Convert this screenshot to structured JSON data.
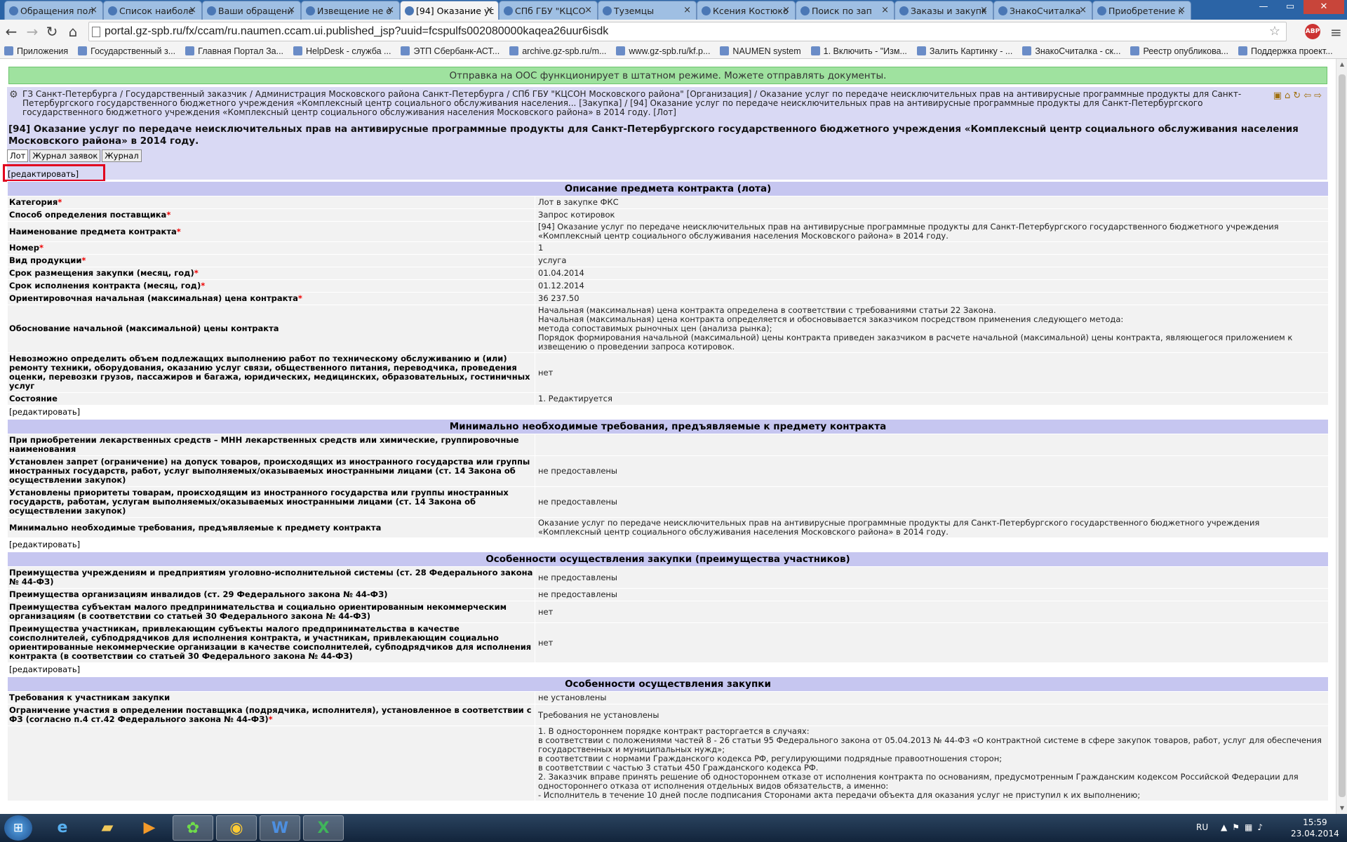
{
  "browser": {
    "tabs": [
      {
        "label": "Обращения пол"
      },
      {
        "label": "Список наиболе"
      },
      {
        "label": "Ваши обращени"
      },
      {
        "label": "Извещение не о"
      },
      {
        "label": "[94] Оказание ус"
      },
      {
        "label": "СПб ГБУ \"КЦСО"
      },
      {
        "label": "Туземцы"
      },
      {
        "label": "Ксения Костюко"
      },
      {
        "label": "Поиск по зап"
      },
      {
        "label": "Заказы и закупк"
      },
      {
        "label": "ЗнакоСчиталка"
      },
      {
        "label": "Приобретение к"
      }
    ],
    "url": "portal.gz-spb.ru/fx/ccam/ru.naumen.ccam.ui.published_jsp?uuid=fcspulfs002080000kaqea26uur6isdk",
    "abp_label": "ABP",
    "bookmarks": [
      {
        "label": "Приложения"
      },
      {
        "label": "Государственный з..."
      },
      {
        "label": "Главная Портал За..."
      },
      {
        "label": "HelpDesk - служба ..."
      },
      {
        "label": "ЭТП Сбербанк-АСТ..."
      },
      {
        "label": "archive.gz-spb.ru/m..."
      },
      {
        "label": "www.gz-spb.ru/kf.p..."
      },
      {
        "label": "NAUMEN system"
      },
      {
        "label": "1. Включить - \"Изм..."
      },
      {
        "label": "Залить Картинку - ..."
      },
      {
        "label": "ЗнакоСчиталка - ск..."
      },
      {
        "label": "Реестр опубликова..."
      },
      {
        "label": "Поддержка проект..."
      }
    ]
  },
  "page": {
    "status_message": "Отправка на ООС функционирует в штатном режиме. Можете отправлять документы.",
    "breadcrumb": "ГЗ Санкт-Петербурга / Государственный заказчик / Администрация Московского района Санкт-Петербурга / СПб ГБУ \"КЦСОН Московского района\" [Организация] / Оказание услуг по передаче неисключительных прав на антивирусные программные продукты для Санкт-Петербургского государственного бюджетного учреждения «Комплексный центр социального обслуживания населения... [Закупка] / [94] Оказание услуг по передаче неисключительных прав на антивирусные программные продукты для Санкт-Петербургского государственного бюджетного учреждения «Комплексный центр социального обслуживания населения Московского района» в 2014 году. [Лот]",
    "title": "[94] Оказание услуг по передаче неисключительных прав на антивирусные программные продукты для Санкт-Петербургского государственного бюджетного учреждения «Комплексный центр социального обслуживания населения Московского района» в 2014 году.",
    "tabs": [
      "Лот",
      "Журнал заявок",
      "Журнал"
    ],
    "edit_label": "[редактировать]",
    "sections": [
      {
        "title": "Описание предмета контракта (лота)",
        "rows": [
          {
            "label": "Категория",
            "required": "*",
            "value": "Лот в закупке ФКС"
          },
          {
            "label": "Способ определения поставщика",
            "required": "*",
            "value": "Запрос котировок"
          },
          {
            "label": "Наименование предмета контракта",
            "required": "*",
            "value": "[94] Оказание услуг по передаче неисключительных прав на антивирусные программные продукты для Санкт-Петербургского государственного бюджетного учреждения «Комплексный центр социального обслуживания населения Московского района» в 2014 году."
          },
          {
            "label": "Номер",
            "required": "*",
            "value": "1"
          },
          {
            "label": "Вид продукции",
            "required": "*",
            "value": "услуга"
          },
          {
            "label": "Срок размещения закупки (месяц, год)",
            "required": "*",
            "value": "01.04.2014"
          },
          {
            "label": "Срок исполнения контракта (месяц, год)",
            "required": "*",
            "value": "01.12.2014"
          },
          {
            "label": "Ориентировочная начальная (максимальная) цена контракта",
            "required": "*",
            "value": "36 237.50"
          },
          {
            "label": "Обоснование начальной (максимальной) цены контракта",
            "required": "",
            "value": "Начальная (максимальная) цена контракта определена в соответствии с требованиями статьи 22 Закона.\nНачальная (максимальная) цена контракта определяется и обосновывается заказчиком посредством применения следующего метода:\nметода сопоставимых рыночных цен (анализа рынка);\nПорядок формирования начальной (максимальной) цены контракта приведен заказчиком в расчете начальной (максимальной) цены контракта, являющегося приложением к извещению о проведении запроса котировок."
          },
          {
            "label": "Невозможно определить объем подлежащих выполнению работ по техническому обслуживанию и (или) ремонту техники, оборудования, оказанию услуг связи, общественного питания, переводчика, проведения оценки, перевозки грузов, пассажиров и багажа, юридических, медицинских, образовательных, гостиничных услуг",
            "required": "",
            "value": "нет"
          },
          {
            "label": "Состояние",
            "required": "",
            "value": "1. Редактируется"
          }
        ]
      },
      {
        "title": "Минимально необходимые требования, предъявляемые к предмету контракта",
        "rows": [
          {
            "label": "При приобретении лекарственных средств – МНН лекарственных средств или химические, группировочные наименования",
            "required": "",
            "value": ""
          },
          {
            "label": "Установлен запрет (ограничение) на допуск товаров, происходящих из иностранного государства или группы иностранных государств, работ, услуг выполняемых/оказываемых иностранными лицами (ст. 14 Закона об осуществлении закупок)",
            "required": "",
            "value": "не предоставлены"
          },
          {
            "label": "Установлены приоритеты товарам, происходящим из иностранного государства или группы иностранных государств, работам, услугам выполняемых/оказываемых иностранными лицами (ст. 14 Закона об осуществлении закупок)",
            "required": "",
            "value": "не предоставлены"
          },
          {
            "label": "Минимально необходимые требования, предъявляемые к предмету контракта",
            "required": "",
            "value": "Оказание услуг по передаче неисключительных прав на антивирусные программные продукты для Санкт-Петербургского государственного бюджетного учреждения «Комплексный центр социального обслуживания населения Московского района» в 2014 году."
          }
        ]
      },
      {
        "title": "Особенности осуществления закупки (преимущества участников)",
        "rows": [
          {
            "label": "Преимущества учреждениям и предприятиям уголовно-исполнительной системы (ст. 28 Федерального закона № 44-ФЗ)",
            "required": "",
            "value": "не предоставлены"
          },
          {
            "label": "Преимущества организациям инвалидов (ст. 29 Федерального закона № 44-ФЗ)",
            "required": "",
            "value": "не предоставлены"
          },
          {
            "label": "Преимущества субъектам малого предпринимательства и социально ориентированным некоммерческим организациям (в соответствии со статьей 30 Федерального закона № 44-ФЗ)",
            "required": "",
            "value": "нет"
          },
          {
            "label": "Преимущества участникам, привлекающим субъекты малого предпринимательства в качестве соисполнителей, субподрядчиков для исполнения контракта, и участникам, привлекающим социально ориентированные некоммерческие организации в качестве соисполнителей, субподрядчиков для исполнения контракта (в соответствии со статьей 30 Федерального закона № 44-ФЗ)",
            "required": "",
            "value": "нет"
          }
        ]
      },
      {
        "title": "Особенности осуществления закупки",
        "rows": [
          {
            "label": "Требования к участникам закупки",
            "required": "",
            "value": "не установлены"
          },
          {
            "label": "Ограничение участия в определении поставщика (подрядчика, исполнителя), установленное в соответствии с ФЗ (согласно п.4 ст.42 Федерального закона № 44-ФЗ)",
            "required": "*",
            "value": "Требования не установлены"
          },
          {
            "label": "",
            "required": "",
            "value": "1. В одностороннем порядке контракт расторгается в случаях:\nв соответствии с положениями частей 8 - 26 статьи 95 Федерального закона от 05.04.2013 № 44-ФЗ «О контрактной системе в сфере закупок товаров, работ, услуг для обеспечения государственных и муниципальных нужд»;\nв соответствии с нормами Гражданского кодекса РФ, регулирующими подрядные правоотношения сторон;\nв соответствии с частью 3 статьи 450 Гражданского кодекса РФ.\n2. Заказчик вправе принять решение об одностороннем отказе от исполнения контракта по основаниям, предусмотренным Гражданским кодексом Российской Федерации для одностороннего отказа от исполнения отдельных видов обязательств, а именно:\n- Исполнитель в течение 10 дней после подписания Сторонами акта передачи объекта для оказания услуг не приступил к их выполнению;"
          }
        ]
      }
    ]
  },
  "taskbar": {
    "lang": "RU",
    "time": "15:59",
    "date": "23.04.2014"
  },
  "colors": {
    "status_bar": "#9fe29f",
    "section_header": "#c6c6f0",
    "breadcrumb_bg": "#d9d9f4",
    "row_bg": "#f2f2f2",
    "highlight_box": "#e1001e",
    "tabstrip": "#2b64a6"
  },
  "icons": {
    "browser_nav": [
      "back-icon",
      "forward-icon",
      "reload-icon",
      "home-icon"
    ],
    "page_tools": [
      "folder-icon",
      "home-icon",
      "refresh-icon",
      "arrow-left-icon",
      "arrow-right-icon"
    ],
    "taskbar_apps": [
      "windows-start-icon",
      "internet-explorer-icon",
      "file-explorer-icon",
      "media-player-icon",
      "icq-icon",
      "chrome-icon",
      "word-icon",
      "excel-icon"
    ]
  }
}
